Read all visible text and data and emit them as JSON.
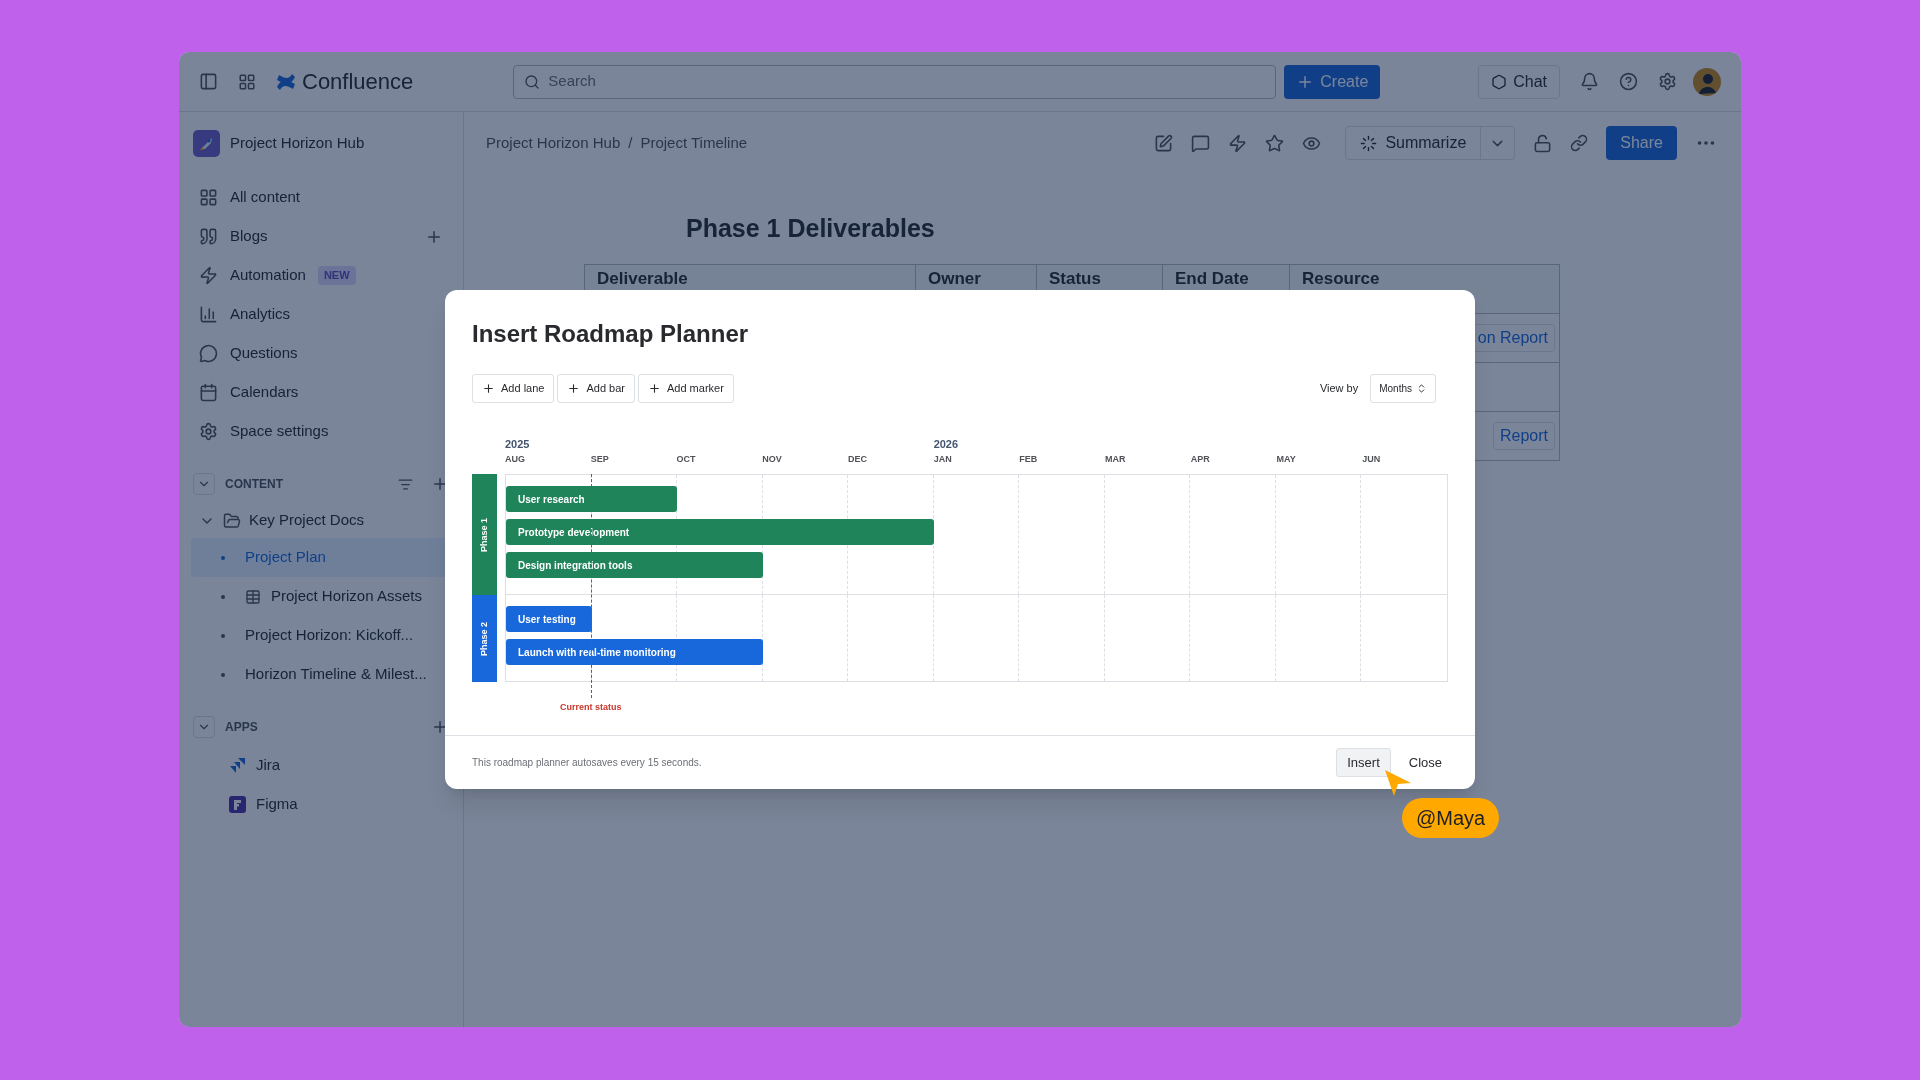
{
  "topbar": {
    "product": "Confluence",
    "search": {
      "placeholder": "Search"
    },
    "create": "Create",
    "chat": "Chat"
  },
  "sidebar": {
    "space": "Project Horizon Hub",
    "nav": [
      {
        "label": "All content",
        "add": false
      },
      {
        "label": "Blogs",
        "add": true
      },
      {
        "label": "Automation",
        "add": false,
        "badge": "NEW"
      },
      {
        "label": "Analytics",
        "add": false
      },
      {
        "label": "Questions",
        "add": false
      },
      {
        "label": "Calendars",
        "add": false
      },
      {
        "label": "Space settings",
        "add": false
      }
    ],
    "content": {
      "label": "CONTENT",
      "expanded": true,
      "items": [
        {
          "label": "Key Project Docs",
          "kind": "folder",
          "expanded": true,
          "children": [
            {
              "label": "Project Plan",
              "kind": "page",
              "selected": true
            },
            {
              "label": "Project Horizon Assets",
              "kind": "database",
              "selected": false
            },
            {
              "label": "Project Horizon: Kickoff...",
              "kind": "page",
              "selected": false
            },
            {
              "label": "Horizon Timeline & Milest...",
              "kind": "page",
              "selected": false
            }
          ]
        }
      ]
    },
    "apps": {
      "label": "APPS",
      "expanded": true,
      "items": [
        {
          "label": "Jira",
          "kind": "jira"
        },
        {
          "label": "Figma",
          "kind": "figma"
        }
      ]
    }
  },
  "page": {
    "breadcrumbs": [
      "Project Horizon Hub",
      "Project Timeline"
    ],
    "breadcrumb_separator": "/",
    "summarize": "Summarize",
    "share": "Share",
    "title": "Phase 1 Deliverables",
    "table": {
      "columns": [
        "Deliverable",
        "Owner",
        "Status",
        "End Date",
        "Resource"
      ],
      "rows": [
        {
          "resource": "on Report"
        },
        {},
        {
          "resource": "Report"
        }
      ]
    }
  },
  "modal": {
    "title": "Insert Roadmap Planner",
    "toolbar": [
      "Add lane",
      "Add bar",
      "Add marker"
    ],
    "view_by": {
      "label": "View by",
      "value": "Months"
    },
    "months": [
      {
        "label": "AUG",
        "year": "2025"
      },
      {
        "label": "SEP"
      },
      {
        "label": "OCT"
      },
      {
        "label": "NOV"
      },
      {
        "label": "DEC"
      },
      {
        "label": "JAN",
        "year": "2026"
      },
      {
        "label": "FEB"
      },
      {
        "label": "MAR"
      },
      {
        "label": "APR"
      },
      {
        "label": "MAY"
      },
      {
        "label": "JUN"
      }
    ],
    "lanes": [
      {
        "label": "Phase 1",
        "color": "#1f845a",
        "bars": [
          {
            "label": "User research",
            "level": 0.1818
          },
          {
            "label": "Prototype development",
            "level": 0.4545
          },
          {
            "label": "Design integration tools",
            "level": 0.2727
          }
        ]
      },
      {
        "label": "Phase 2",
        "color": "#1868db",
        "bars": [
          {
            "label": "User testing",
            "level": 0.0909
          },
          {
            "label": "Launch with real-time monitoring",
            "level": 0.2727
          }
        ]
      }
    ],
    "marker": {
      "label": "Current status",
      "level": 0.0909
    },
    "note": "This roadmap planner autosaves every 15 seconds.",
    "insert": "Insert",
    "close": "Close"
  },
  "cursor": {
    "label": "@Maya"
  }
}
